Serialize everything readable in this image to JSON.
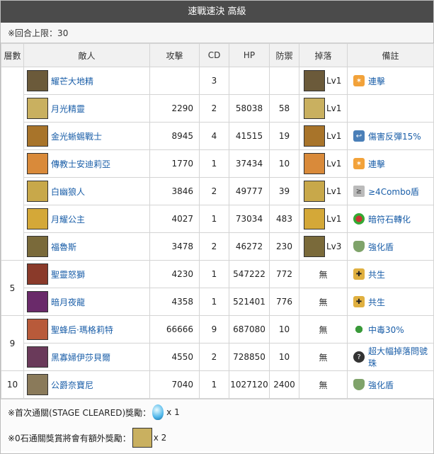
{
  "title": "速戰速決 高級",
  "turn_limit": "※回合上限：30",
  "headers": [
    "層數",
    "敵人",
    "攻擊",
    "CD",
    "HP",
    "防禦",
    "掉落",
    "備註"
  ],
  "rows": [
    {
      "name": "耀芒大地精",
      "atk": "",
      "cd": "3",
      "hp": "",
      "def": "",
      "drop": "Lv1",
      "note": "連擊",
      "icon": "combo-icon",
      "portrait": "#6b5a3a"
    },
    {
      "name": "月光精靈",
      "atk": "2290",
      "cd": "2",
      "hp": "58038",
      "def": "58",
      "drop": "Lv1",
      "note": "",
      "icon": "",
      "portrait": "#c9b060"
    },
    {
      "name": "金光蜥蜴戰士",
      "atk": "8945",
      "cd": "4",
      "hp": "41515",
      "def": "19",
      "drop": "Lv1",
      "note": "傷害反彈15%",
      "icon": "reflect-icon",
      "portrait": "#a8742a"
    },
    {
      "name": "傳教士安迪莉亞",
      "atk": "1770",
      "cd": "1",
      "hp": "37434",
      "def": "10",
      "drop": "Lv1",
      "note": "連擊",
      "icon": "combo-icon",
      "portrait": "#d98a3a"
    },
    {
      "name": "白幽狼人",
      "atk": "3846",
      "cd": "2",
      "hp": "49777",
      "def": "39",
      "drop": "Lv1",
      "note": "≥4Combo盾",
      "icon": "combo-shield-icon",
      "portrait": "#c8a84a"
    },
    {
      "name": "月耀公主",
      "atk": "4027",
      "cd": "1",
      "hp": "73034",
      "def": "483",
      "drop": "Lv1",
      "note": "暗符石轉化",
      "icon": "rune-convert-icon",
      "portrait": "#d4a838"
    },
    {
      "name": "福魯斯",
      "atk": "3478",
      "cd": "2",
      "hp": "46272",
      "def": "230",
      "drop": "Lv3",
      "note": "強化盾",
      "icon": "shield-icon",
      "portrait": "#7a6a3a"
    },
    {
      "name": "聖靈怒獅",
      "atk": "4230",
      "cd": "1",
      "hp": "547222",
      "def": "772",
      "drop": "無",
      "note": "共生",
      "icon": "symbiosis-icon",
      "portrait": "#8a3a2a"
    },
    {
      "name": "暗月夜龍",
      "atk": "4358",
      "cd": "1",
      "hp": "521401",
      "def": "776",
      "drop": "無",
      "note": "共生",
      "icon": "symbiosis-icon",
      "portrait": "#6a2a6a"
    },
    {
      "name": "聖蜂后·瑪格莉特",
      "atk": "66666",
      "cd": "9",
      "hp": "687080",
      "def": "10",
      "drop": "無",
      "note": "中毒30%",
      "icon": "poison-icon",
      "portrait": "#b85a3a"
    },
    {
      "name": "黑寡婦伊莎貝爾",
      "atk": "4550",
      "cd": "2",
      "hp": "728850",
      "def": "10",
      "drop": "無",
      "note": "超大幅掉落問號珠",
      "icon": "question-orb-icon",
      "portrait": "#6a3a5a"
    },
    {
      "name": "公爵奈寶尼",
      "atk": "7040",
      "cd": "1",
      "hp": "1027120",
      "def": "2400",
      "drop": "無",
      "note": "強化盾",
      "icon": "shield-icon",
      "portrait": "#8a7a5a"
    }
  ],
  "floors": [
    {
      "label": "",
      "span": 7
    },
    {
      "label": "5",
      "span": 2
    },
    {
      "label": "9",
      "span": 2
    },
    {
      "label": "10",
      "span": 1
    }
  ],
  "footer": {
    "reward1_label": "※首次通關(STAGE CLEARED)獎勵：",
    "reward1_qty": "x 1",
    "reward2_label": "※0石通關獎賞將會有額外獎勵：",
    "reward2_qty": "x 2"
  }
}
